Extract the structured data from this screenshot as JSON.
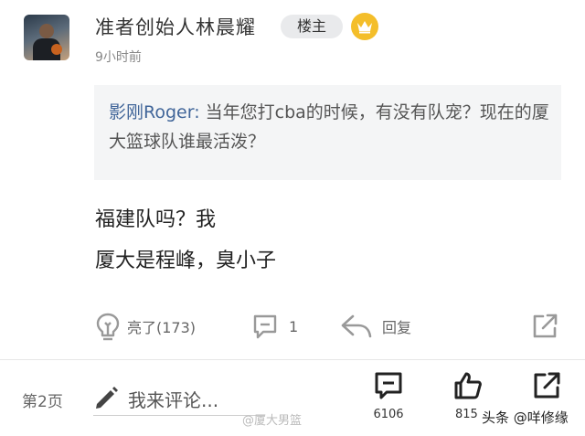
{
  "header": {
    "username": "准者创始人林晨耀",
    "owner_badge": "楼主",
    "time": "9小时前"
  },
  "quote": {
    "author": "影刚Roger:",
    "text": " 当年您打cba的时候，有没有队宠？现在的厦大篮球队谁最活泼？"
  },
  "content": {
    "line1": "福建队吗？我",
    "line2": "厦大是程峰，臭小子"
  },
  "actions": {
    "like_label": "亮了(173)",
    "comment_count": "1",
    "reply_label": "回复"
  },
  "bottom_bar": {
    "page_label": "第2页",
    "comment_placeholder": "我来评论...",
    "comments_count": "6106",
    "likes_count": "815"
  },
  "watermark": {
    "weibo": "@厦大男篮",
    "toutiao": "头条 @咩修缘"
  },
  "colors": {
    "author_link": "#406599",
    "crown_gold": "#f4be2a",
    "quote_bg": "#f4f5f6",
    "badge_bg": "#e9eaec"
  },
  "icons": [
    "lightbulb-icon",
    "comment-icon",
    "reply-icon",
    "share-icon",
    "pencil-icon",
    "crown-icon"
  ]
}
